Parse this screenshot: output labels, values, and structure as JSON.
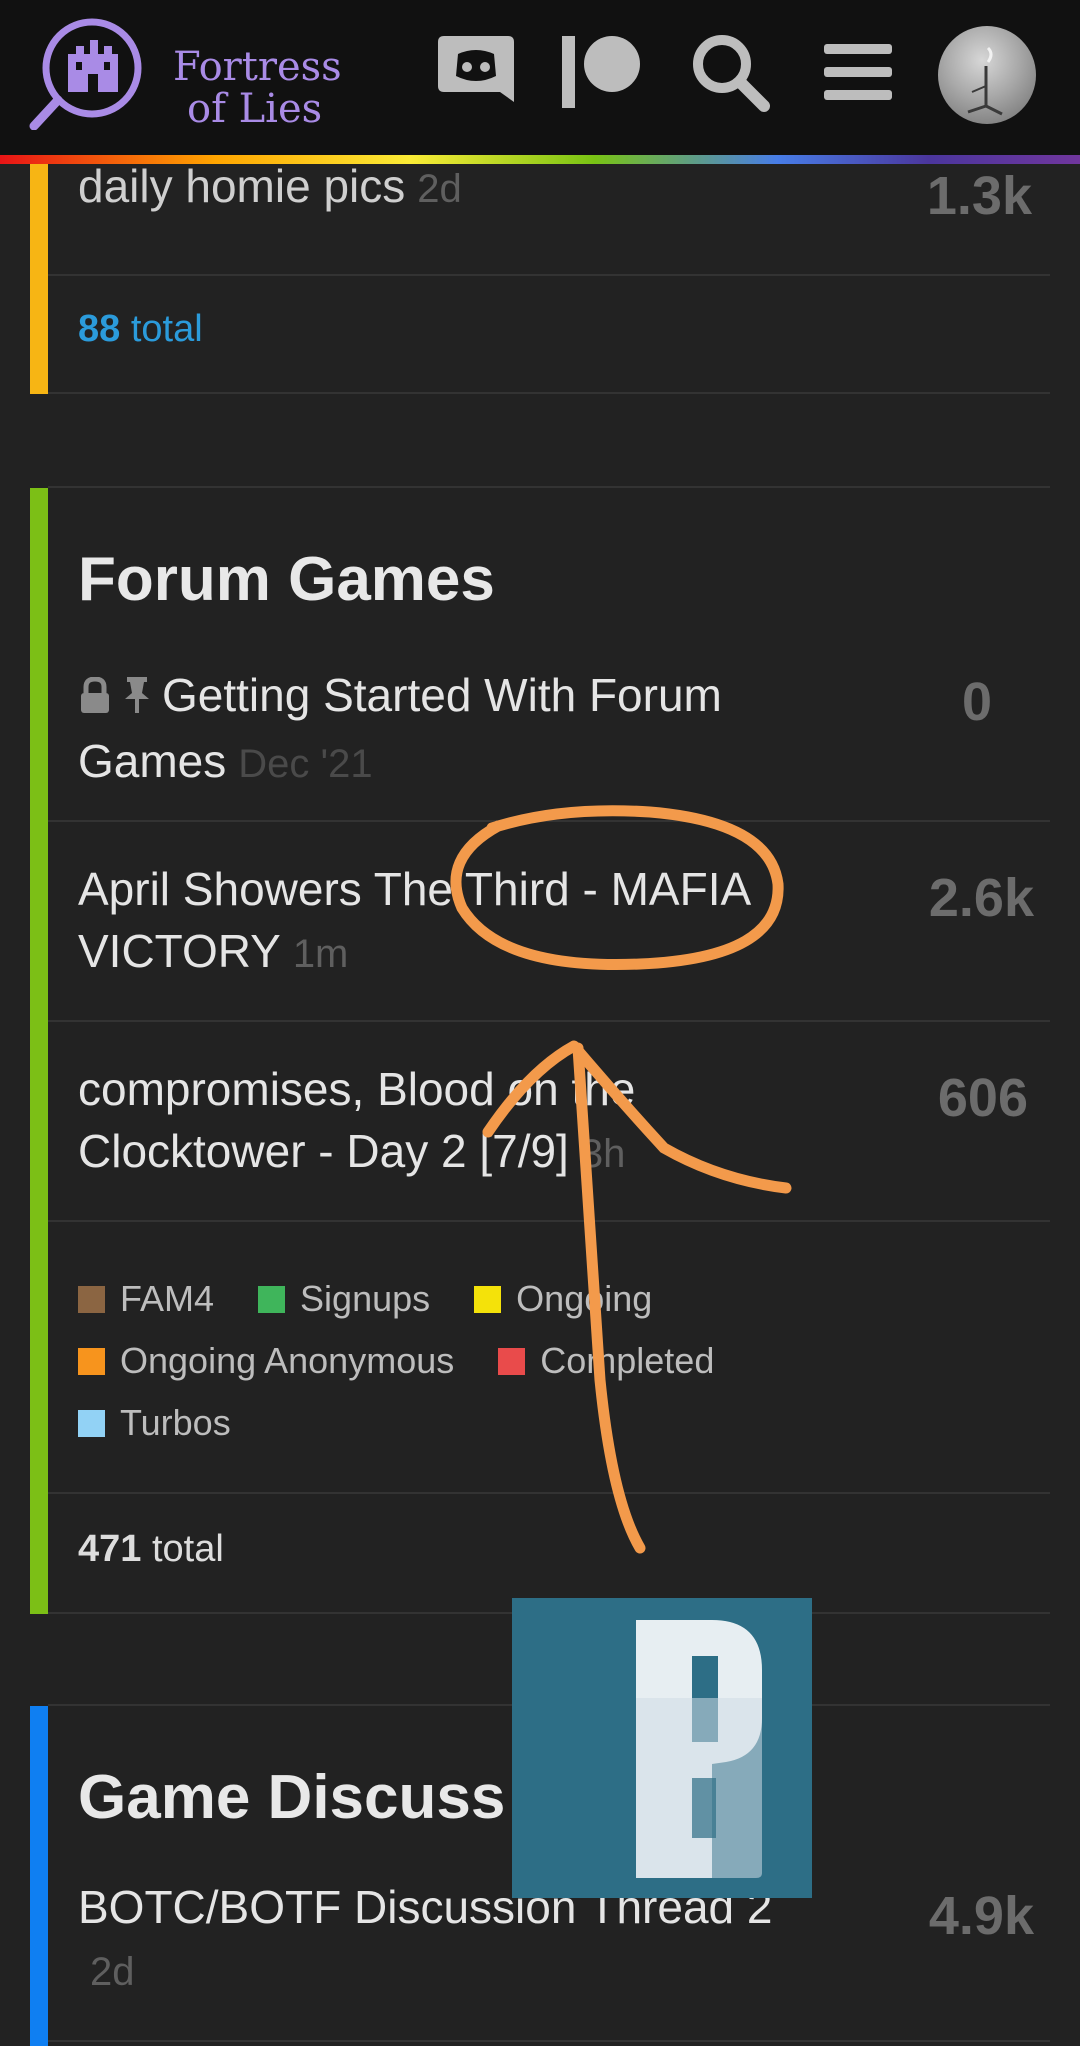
{
  "header": {
    "logo_line1": "Fortress",
    "logo_line2": "of Lies",
    "icons": [
      "discord-icon",
      "patreon-icon",
      "search-icon",
      "hamburger-menu-icon",
      "user-avatar"
    ]
  },
  "colors": {
    "accent_purple": "#a98be6",
    "annotation_orange": "#f39a4b",
    "total_link_blue": "#2b9bdb",
    "bar_yellow": "#f7b514",
    "bar_green": "#7cbf16",
    "bar_blue": "#0f7ff2"
  },
  "prev_category": {
    "topic": {
      "title": "daily homie pics",
      "age": "2d",
      "count": "1.3k"
    },
    "total_num": "88",
    "total_word": "total"
  },
  "forum_games": {
    "title": "Forum Games",
    "topics": [
      {
        "title": "Getting Started With Forum Games",
        "age": "Dec '21",
        "count": "0",
        "locked": true,
        "pinned": true
      },
      {
        "title_line1": "April Showers The Third - MAFIA",
        "title_line2": "VICTORY",
        "age": "1m",
        "count": "2.6k"
      },
      {
        "title_line1": "compromises, Blood on the",
        "title_line2": "Clocktower - Day 2 [7/9]",
        "age": "3h",
        "count": "606"
      }
    ],
    "subcategories": [
      {
        "name": "FAM4",
        "color": "#8b6542"
      },
      {
        "name": "Signups",
        "color": "#3fb55b"
      },
      {
        "name": "Ongoing",
        "color": "#f4e20a"
      },
      {
        "name": "Ongoing Anonymous",
        "color": "#f7941d"
      },
      {
        "name": "Completed",
        "color": "#e94b4b"
      },
      {
        "name": "Turbos",
        "color": "#92d2f5"
      }
    ],
    "total_num": "471",
    "total_word": "total"
  },
  "game_discussion": {
    "title": "Game Discuss",
    "topics": [
      {
        "title": "BOTC/BOTF Discussion Thread 2",
        "age": "2d",
        "count": "4.9k"
      }
    ]
  },
  "overlay": {
    "tile_letter": "P"
  }
}
